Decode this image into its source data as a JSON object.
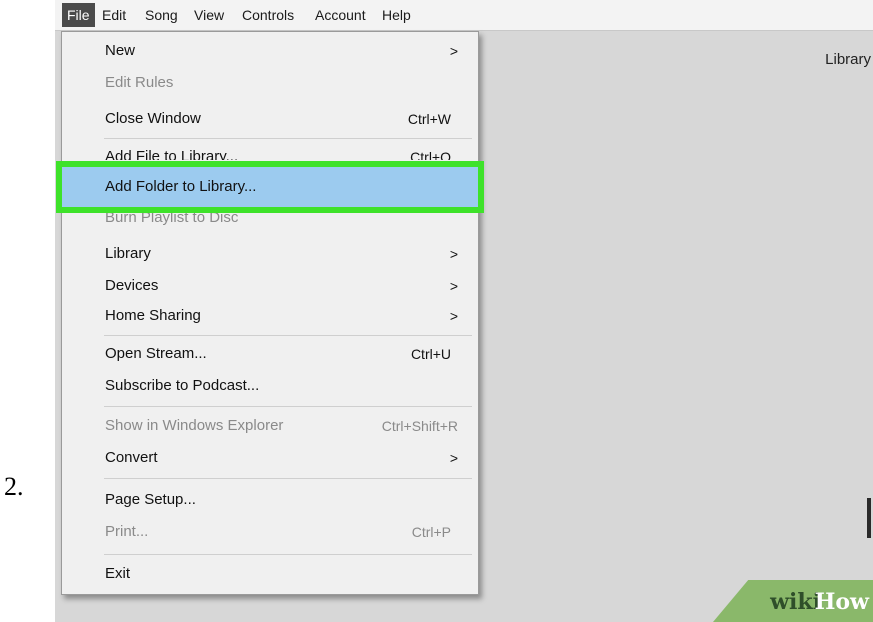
{
  "step": {
    "number": "2."
  },
  "menubar": {
    "items": [
      {
        "label": "File",
        "active": true
      },
      {
        "label": "Edit"
      },
      {
        "label": "Song"
      },
      {
        "label": "View"
      },
      {
        "label": "Controls"
      },
      {
        "label": "Account"
      },
      {
        "label": "Help"
      }
    ]
  },
  "main": {
    "library_label": "Library"
  },
  "file_menu": {
    "items": [
      {
        "label": "New",
        "shortcut": "",
        "submenu": true,
        "enabled": true
      },
      {
        "label": "Edit Rules",
        "shortcut": "",
        "submenu": false,
        "enabled": false
      },
      {
        "label": "Close Window",
        "shortcut": "Ctrl+W",
        "submenu": false,
        "enabled": true
      },
      {
        "label": "Add File to Library...",
        "shortcut": "Ctrl+O",
        "submenu": false,
        "enabled": true
      },
      {
        "label": "Add Folder to Library...",
        "shortcut": "",
        "submenu": false,
        "enabled": true,
        "highlighted": true
      },
      {
        "label": "Burn Playlist to Disc",
        "shortcut": "",
        "submenu": false,
        "enabled": false
      },
      {
        "label": "Library",
        "shortcut": "",
        "submenu": true,
        "enabled": true
      },
      {
        "label": "Devices",
        "shortcut": "",
        "submenu": true,
        "enabled": true
      },
      {
        "label": "Home Sharing",
        "shortcut": "",
        "submenu": true,
        "enabled": true
      },
      {
        "label": "Open Stream...",
        "shortcut": "Ctrl+U",
        "submenu": false,
        "enabled": true
      },
      {
        "label": "Subscribe to Podcast...",
        "shortcut": "",
        "submenu": false,
        "enabled": true
      },
      {
        "label": "Show in Windows Explorer",
        "shortcut": "Ctrl+Shift+R",
        "submenu": false,
        "enabled": false
      },
      {
        "label": "Convert",
        "shortcut": "",
        "submenu": true,
        "enabled": true
      },
      {
        "label": "Page Setup...",
        "shortcut": "",
        "submenu": false,
        "enabled": true
      },
      {
        "label": "Print...",
        "shortcut": "Ctrl+P",
        "submenu": false,
        "enabled": false
      },
      {
        "label": "Exit",
        "shortcut": "",
        "submenu": false,
        "enabled": true
      }
    ],
    "submenu_arrow": ">"
  },
  "highlight_color": "#3ee22a",
  "selection_color": "#9ccbef",
  "brand": {
    "wiki": "wiki",
    "how": "How"
  }
}
